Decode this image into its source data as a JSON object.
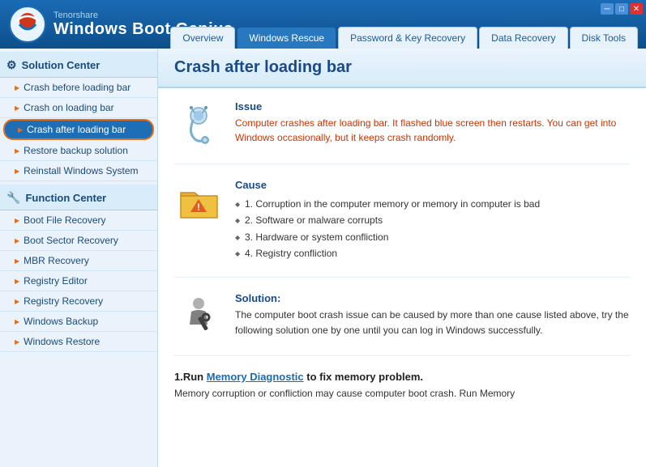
{
  "titleBar": {
    "company": "Tenorshare",
    "appName": "Windows Boot Genius",
    "controls": {
      "minimize": "─",
      "maximize": "□",
      "close": "✕"
    }
  },
  "navTabs": [
    {
      "id": "overview",
      "label": "Overview",
      "active": false
    },
    {
      "id": "windows-rescue",
      "label": "Windows Rescue",
      "active": true
    },
    {
      "id": "password-recovery",
      "label": "Password & Key Recovery",
      "active": false
    },
    {
      "id": "data-recovery",
      "label": "Data Recovery",
      "active": false
    },
    {
      "id": "disk-tools",
      "label": "Disk Tools",
      "active": false
    }
  ],
  "sidebar": {
    "sections": [
      {
        "id": "solution-center",
        "label": "Solution Center",
        "items": [
          {
            "id": "crash-before",
            "label": "Crash before loading bar",
            "active": false
          },
          {
            "id": "crash-on",
            "label": "Crash on loading bar",
            "active": false
          },
          {
            "id": "crash-after",
            "label": "Crash after loading bar",
            "active": true
          },
          {
            "id": "restore-backup",
            "label": "Restore backup solution",
            "active": false
          },
          {
            "id": "reinstall-windows",
            "label": "Reinstall Windows System",
            "active": false
          }
        ]
      },
      {
        "id": "function-center",
        "label": "Function Center",
        "items": [
          {
            "id": "boot-file",
            "label": "Boot File Recovery",
            "active": false
          },
          {
            "id": "boot-sector",
            "label": "Boot Sector Recovery",
            "active": false
          },
          {
            "id": "mbr-recovery",
            "label": "MBR Recovery",
            "active": false
          },
          {
            "id": "registry-editor",
            "label": "Registry Editor",
            "active": false
          },
          {
            "id": "registry-recovery",
            "label": "Registry Recovery",
            "active": false
          },
          {
            "id": "windows-backup",
            "label": "Windows Backup",
            "active": false
          },
          {
            "id": "windows-restore",
            "label": "Windows Restore",
            "active": false
          }
        ]
      }
    ]
  },
  "content": {
    "title": "Crash after loading bar",
    "sections": [
      {
        "id": "issue",
        "icon": "stethoscope",
        "label": "Issue",
        "text": "Computer crashes after loading bar. It flashed blue screen then restarts. You can get into Windows occasionally, but it keeps crash randomly."
      },
      {
        "id": "cause",
        "icon": "folder-warning",
        "label": "Cause",
        "items": [
          "1. Corruption in the computer memory or memory in computer is bad",
          "2. Software or malware corrupts",
          "3. Hardware or system confliction",
          "4. Registry confliction"
        ]
      },
      {
        "id": "solution",
        "icon": "wrench",
        "label": "Solution:",
        "text": "The computer boot crash issue can be caused by more than one cause listed above, try the following solution one by one until you can log in Windows successfully."
      },
      {
        "id": "step1",
        "label": "1.Run Memory Diagnostic to fix memory problem.",
        "linkText": "Memory Diagnostic",
        "text": "Memory corruption or confliction may cause computer boot crash. Run Memory"
      }
    ]
  }
}
